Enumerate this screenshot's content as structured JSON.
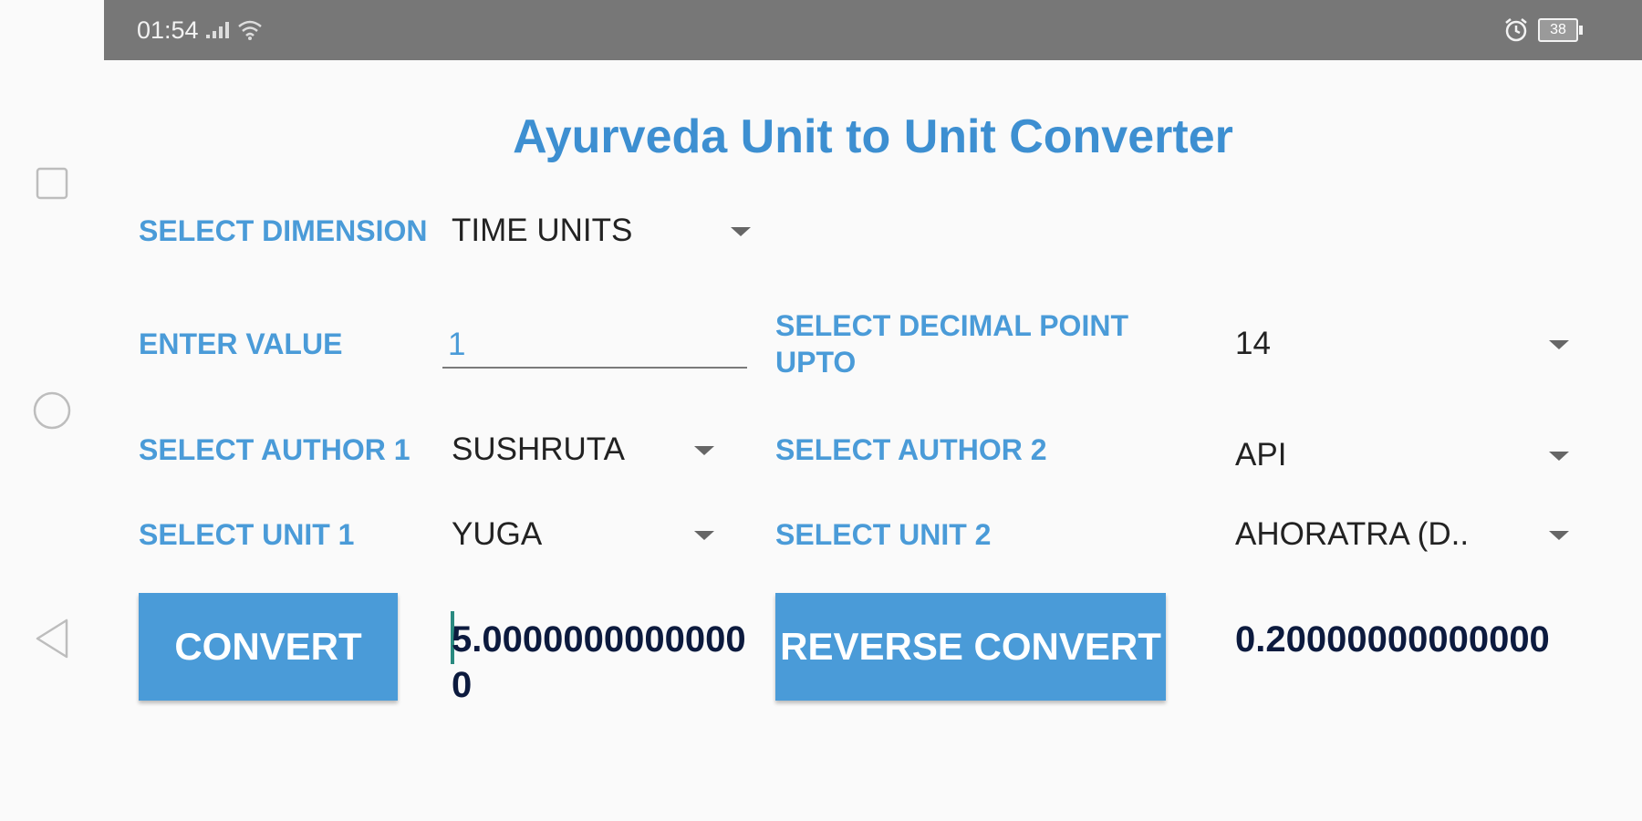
{
  "status_bar": {
    "time": "01:54",
    "battery": "38"
  },
  "app": {
    "title": "Ayurveda Unit to Unit Converter"
  },
  "form": {
    "dimension_label": "SELECT DIMENSION",
    "dimension_value": "TIME UNITS",
    "value_label": "ENTER VALUE",
    "value_input": "1",
    "decimal_label": "SELECT DECIMAL POINT UPTO",
    "decimal_value": "14",
    "author1_label": "SELECT AUTHOR 1",
    "author1_value": "SUSHRUTA",
    "author2_label": "SELECT AUTHOR 2",
    "author2_value": "API",
    "unit1_label": "SELECT UNIT 1",
    "unit1_value": "YUGA",
    "unit2_label": "SELECT UNIT 2",
    "unit2_value": "AHORATRA (D.."
  },
  "actions": {
    "convert_label": "CONVERT",
    "reverse_label": "REVERSE CONVERT"
  },
  "results": {
    "convert_result": "5.00000000000000",
    "reverse_result": "0.20000000000000"
  },
  "colors": {
    "accent": "#4a9bd8",
    "title": "#3d8fd1",
    "status_bar": "#777777",
    "result_text": "#0c1a3e"
  },
  "icons": {
    "nav_square": "square-icon",
    "nav_home": "circle-icon",
    "nav_back": "back-triangle-icon",
    "signal": "signal-icon",
    "wifi": "wifi-icon",
    "alarm": "alarm-icon",
    "battery": "battery-icon"
  }
}
